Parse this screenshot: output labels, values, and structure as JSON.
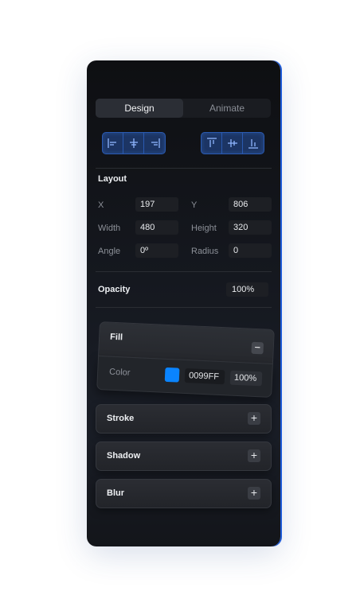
{
  "tabs": [
    {
      "label": "Design",
      "active": true
    },
    {
      "label": "Animate",
      "active": false
    }
  ],
  "align_horizontal": [
    "align-left-icon",
    "align-center-horizontal-icon",
    "align-right-icon"
  ],
  "align_vertical": [
    "align-top-icon",
    "align-middle-vertical-icon",
    "align-bottom-icon"
  ],
  "layout": {
    "title": "Layout",
    "x": {
      "label": "X",
      "value": "197"
    },
    "y": {
      "label": "Y",
      "value": "806"
    },
    "width": {
      "label": "Width",
      "value": "480"
    },
    "height": {
      "label": "Height",
      "value": "320"
    },
    "angle": {
      "label": "Angle",
      "value": "0º"
    },
    "radius": {
      "label": "Radius",
      "value": "0"
    }
  },
  "opacity": {
    "label": "Opacity",
    "value": "100%"
  },
  "fill": {
    "title": "Fill",
    "color_label": "Color",
    "hex": "0099FF",
    "percent": "100%",
    "swatch_color": "#0A84FF"
  },
  "stroke": {
    "title": "Stroke"
  },
  "shadow": {
    "title": "Shadow"
  },
  "blur": {
    "title": "Blur"
  },
  "colors": {
    "accent": "#1E5BD8",
    "panel": "#15181F"
  }
}
